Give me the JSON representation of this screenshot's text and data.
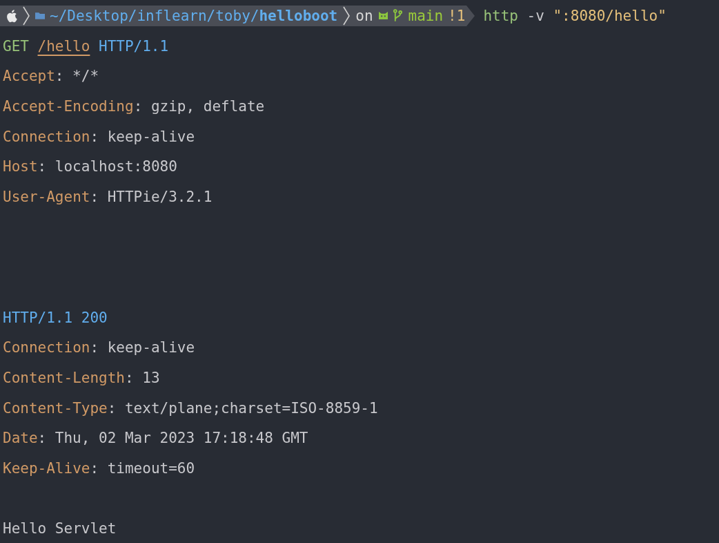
{
  "prompt": {
    "path": "~/Desktop/inflearn/toby/**helloboot**",
    "on": "on",
    "branch": "main",
    "git_status": "!1",
    "command": {
      "program": "http",
      "flag": "-v",
      "argument": "\":8080/hello\""
    }
  },
  "request": {
    "method": "GET",
    "path": "/hello",
    "version": "HTTP/1.1",
    "headers": [
      {
        "name": "Accept",
        "separator": ":",
        "value": "*/*"
      },
      {
        "name": "Accept-Encoding",
        "separator": ":",
        "value": "gzip, deflate"
      },
      {
        "name": "Connection",
        "separator": ":",
        "value": "keep-alive"
      },
      {
        "name": "Host",
        "separator": ":",
        "value": "localhost:8080"
      },
      {
        "name": "User-Agent",
        "separator": ":",
        "value": "HTTPie/3.2.1"
      }
    ]
  },
  "response": {
    "status_line": "HTTP/1.1 200",
    "headers": [
      {
        "name": "Connection",
        "separator": ":",
        "value": "keep-alive"
      },
      {
        "name": "Content-Length",
        "separator": ":",
        "value": "13"
      },
      {
        "name": "Content-Type",
        "separator": ":",
        "value": "text/plane;charset=ISO-8859-1"
      },
      {
        "name": "Date",
        "separator": ":",
        "value": "Thu, 02 Mar 2023 17:18:48 GMT"
      },
      {
        "name": "Keep-Alive",
        "separator": ":",
        "value": "timeout=60"
      }
    ],
    "body": "Hello Servlet"
  }
}
